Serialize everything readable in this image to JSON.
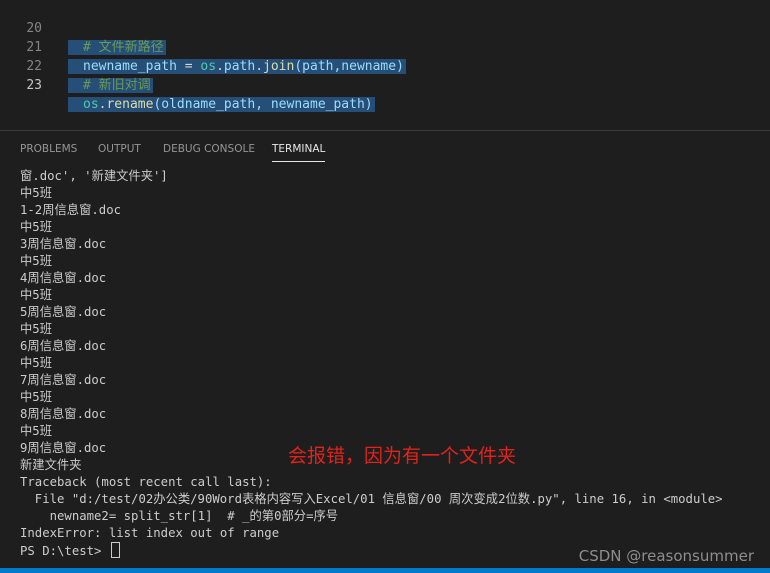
{
  "editor": {
    "lines": [
      {
        "number": "20",
        "comment": "# 文件新路径"
      },
      {
        "number": "21",
        "var": "newname_path",
        "op": " = ",
        "mod": "os",
        "dot": ".",
        "attr": "path",
        "dot2": ".",
        "fn": "join",
        "args": "(path,newname)"
      },
      {
        "number": "22",
        "comment": "# 新旧对调"
      },
      {
        "number": "23",
        "mod": "os",
        "dot": ".",
        "fn": "rename",
        "args": "(oldname_path, newname_path)"
      }
    ]
  },
  "panel": {
    "tabs": [
      {
        "label": "PROBLEMS",
        "active": false
      },
      {
        "label": "OUTPUT",
        "active": false
      },
      {
        "label": "DEBUG CONSOLE",
        "active": false
      },
      {
        "label": "TERMINAL",
        "active": true
      }
    ]
  },
  "terminal": {
    "lines": [
      "窗.doc', '新建文件夹']",
      "中5班",
      "1-2周信息窗.doc",
      "中5班",
      "3周信息窗.doc",
      "中5班",
      "4周信息窗.doc",
      "中5班",
      "5周信息窗.doc",
      "中5班",
      "6周信息窗.doc",
      "中5班",
      "7周信息窗.doc",
      "中5班",
      "8周信息窗.doc",
      "中5班",
      "9周信息窗.doc",
      "新建文件夹",
      "Traceback (most recent call last):",
      "  File \"d:/test/02办公类/90Word表格内容写入Excel/01 信息窗/00 周次变成2位数.py\", line 16, in <module>",
      "    newname2= split_str[1]  # _的第0部分=序号",
      "IndexError: list index out of range"
    ],
    "prompt": "PS D:\\test> "
  },
  "annotation": "会报错，因为有一个文件夹",
  "watermark": "CSDN @reasonsummer",
  "colors": {
    "background": "#1e1e1e",
    "selection": "#264f78",
    "comment": "#6a9955",
    "variable": "#9cdcfe",
    "module": "#4ec9b0",
    "function": "#dcdcaa",
    "annotation": "#e0231c",
    "statusbar": "#007acc"
  }
}
